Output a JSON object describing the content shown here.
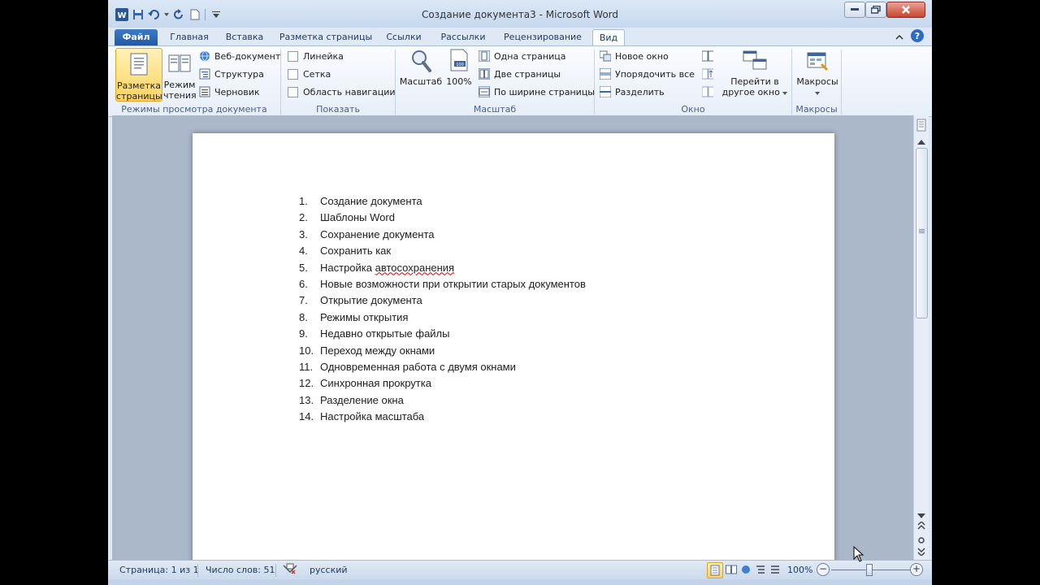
{
  "window": {
    "title": "Создание документа3  -  Microsoft Word"
  },
  "tabs": [
    "Файл",
    "Главная",
    "Вставка",
    "Разметка страницы",
    "Ссылки",
    "Рассылки",
    "Рецензирование",
    "Вид"
  ],
  "ribbon": {
    "views": {
      "label": "Режимы просмотра документа",
      "print_layout": [
        "Разметка",
        "страницы"
      ],
      "reading": [
        "Режим",
        "чтения"
      ],
      "web": "Веб-документ",
      "outline": "Структура",
      "draft": "Черновик"
    },
    "show": {
      "label": "Показать",
      "ruler": "Линейка",
      "grid": "Сетка",
      "nav_pane": "Область навигации"
    },
    "zoom": {
      "label": "Масштаб",
      "zoom_btn": "Масштаб",
      "percent_btn": "100%",
      "one_page": "Одна страница",
      "two_pages": "Две страницы",
      "page_width": "По ширине страницы"
    },
    "window": {
      "label": "Окно",
      "new_window": "Новое окно",
      "arrange_all": "Упорядочить все",
      "split": "Разделить",
      "switch": [
        "Перейти в",
        "другое окно"
      ]
    },
    "macros": {
      "label": "Макросы",
      "btn": "Макросы"
    }
  },
  "document": {
    "items": [
      {
        "n": "1.",
        "text": "Создание документа"
      },
      {
        "n": "2.",
        "text": "Шаблоны Word"
      },
      {
        "n": "3.",
        "text": "Сохранение документа"
      },
      {
        "n": "4.",
        "text": "Сохранить как"
      },
      {
        "n": "5.",
        "text": "Настройка ",
        "spell": "автосохранения"
      },
      {
        "n": "6.",
        "text": "Новые возможности при открытии старых документов"
      },
      {
        "n": "7.",
        "text": "Открытие документа"
      },
      {
        "n": "8.",
        "text": "Режимы открытия"
      },
      {
        "n": "9.",
        "text": "Недавно открытые файлы"
      },
      {
        "n": "10.",
        "text": "Переход между окнами"
      },
      {
        "n": "11.",
        "text": "Одновременная работа с двумя окнами"
      },
      {
        "n": "12.",
        "text": "Синхронная прокрутка"
      },
      {
        "n": "13.",
        "text": "Разделение окна"
      },
      {
        "n": "14.",
        "text": "Настройка масштаба"
      }
    ]
  },
  "status": {
    "page": "Страница: 1 из 1",
    "words": "Число слов: 51",
    "language": "русский",
    "zoom": "100%",
    "zoom_minus": "−",
    "zoom_plus": "+"
  },
  "colors": {
    "accent": "#1e5aa8",
    "ribbon_bg": "#fbfcfe",
    "workspace": "#abb8ca",
    "selected": "#ffd35c"
  }
}
